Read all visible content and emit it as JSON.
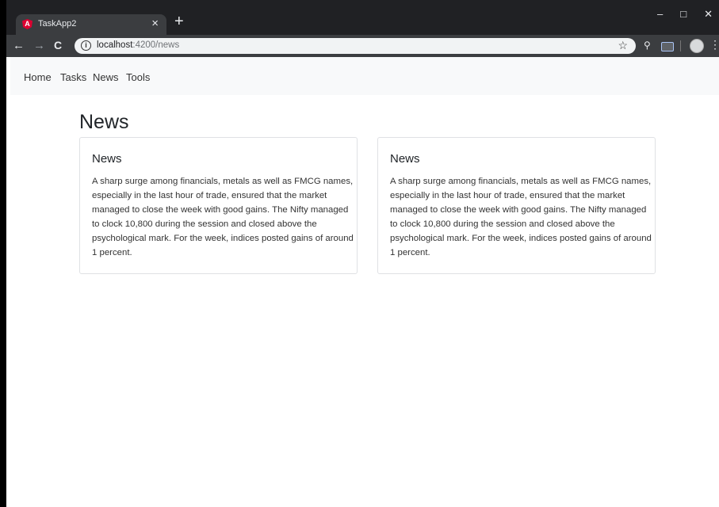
{
  "browser": {
    "tab": {
      "favicon_letter": "A",
      "title": "TaskApp2",
      "close": "×"
    },
    "new_tab": "+",
    "window_controls": {
      "minimize": "–",
      "maximize": "□",
      "close": "✕"
    },
    "nav": {
      "back": "←",
      "forward": "→",
      "reload": "C"
    },
    "address": {
      "info": "i",
      "host": "localhost",
      "path": ":4200/news"
    },
    "star": "☆",
    "extension_key": "⚲",
    "menu": "⋮"
  },
  "navbar": {
    "links": [
      {
        "label": "Home"
      },
      {
        "label": "Tasks"
      },
      {
        "label": "News"
      },
      {
        "label": "Tools"
      }
    ]
  },
  "main": {
    "heading": "News",
    "cards": [
      {
        "title": "News",
        "text": "A sharp surge among financials, metals as well as FMCG names, especially in the last hour of trade, ensured that the market managed to close the week with good gains. The Nifty managed to clock 10,800 during the session and closed above the psychological mark. For the week, indices posted gains of around 1 percent."
      },
      {
        "title": "News",
        "text": "A sharp surge among financials, metals as well as FMCG names, especially in the last hour of trade, ensured that the market managed to close the week with good gains. The Nifty managed to clock 10,800 during the session and closed above the psychological mark. For the week, indices posted gains of around 1 percent."
      }
    ]
  }
}
